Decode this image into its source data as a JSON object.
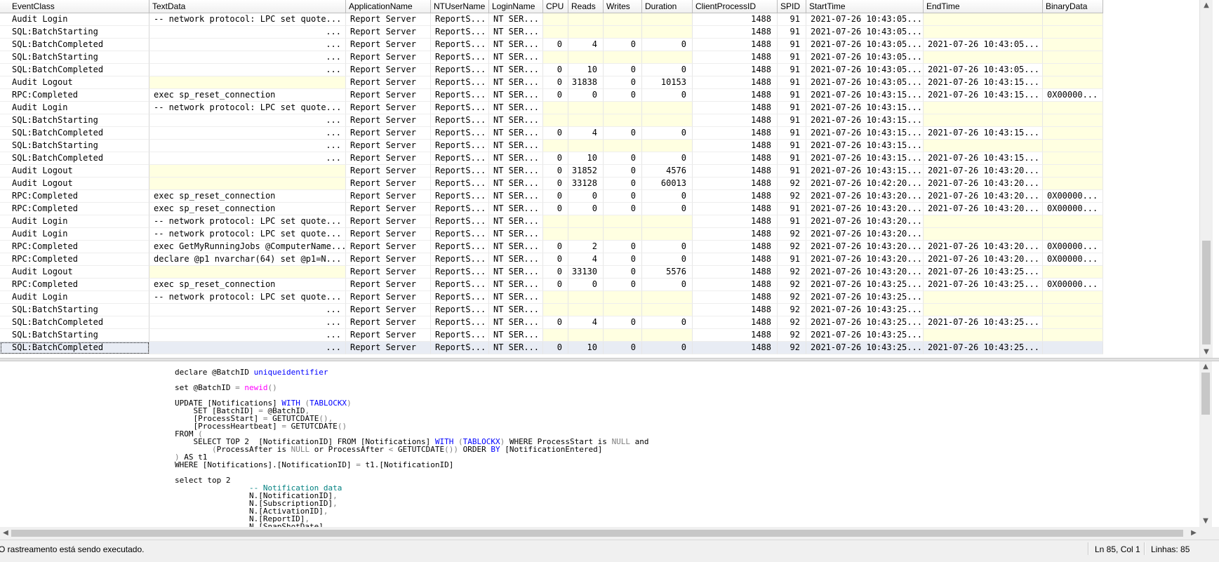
{
  "grid": {
    "columns": [
      "EventClass",
      "TextData",
      "ApplicationName",
      "NTUserName",
      "LoginName",
      "CPU",
      "Reads",
      "Writes",
      "Duration",
      "ClientProcessID",
      "SPID",
      "StartTime",
      "EndTime",
      "BinaryData"
    ],
    "rows": [
      [
        "Audit Login",
        "-- network protocol: LPC  set quote...",
        "Report Server",
        "ReportS...",
        "NT SER...",
        "",
        "",
        "",
        "",
        "1488",
        "91",
        "2021-07-26 10:43:05...",
        "",
        ""
      ],
      [
        "SQL:BatchStarting",
        "...",
        "Report Server",
        "ReportS...",
        "NT SER...",
        "",
        "",
        "",
        "",
        "1488",
        "91",
        "2021-07-26 10:43:05...",
        "",
        ""
      ],
      [
        "SQL:BatchCompleted",
        "...",
        "Report Server",
        "ReportS...",
        "NT SER...",
        "0",
        "4",
        "0",
        "0",
        "1488",
        "91",
        "2021-07-26 10:43:05...",
        "2021-07-26 10:43:05...",
        ""
      ],
      [
        "SQL:BatchStarting",
        "...",
        "Report Server",
        "ReportS...",
        "NT SER...",
        "",
        "",
        "",
        "",
        "1488",
        "91",
        "2021-07-26 10:43:05...",
        "",
        ""
      ],
      [
        "SQL:BatchCompleted",
        "...",
        "Report Server",
        "ReportS...",
        "NT SER...",
        "0",
        "10",
        "0",
        "0",
        "1488",
        "91",
        "2021-07-26 10:43:05...",
        "2021-07-26 10:43:05...",
        ""
      ],
      [
        "Audit Logout",
        "",
        "Report Server",
        "ReportS...",
        "NT SER...",
        "0",
        "31838",
        "0",
        "10153",
        "1488",
        "91",
        "2021-07-26 10:43:05...",
        "2021-07-26 10:43:15...",
        ""
      ],
      [
        "RPC:Completed",
        "exec sp_reset_connection",
        "Report Server",
        "ReportS...",
        "NT SER...",
        "0",
        "0",
        "0",
        "0",
        "1488",
        "91",
        "2021-07-26 10:43:15...",
        "2021-07-26 10:43:15...",
        "0X00000..."
      ],
      [
        "Audit Login",
        "-- network protocol: LPC  set quote...",
        "Report Server",
        "ReportS...",
        "NT SER...",
        "",
        "",
        "",
        "",
        "1488",
        "91",
        "2021-07-26 10:43:15...",
        "",
        ""
      ],
      [
        "SQL:BatchStarting",
        "...",
        "Report Server",
        "ReportS...",
        "NT SER...",
        "",
        "",
        "",
        "",
        "1488",
        "91",
        "2021-07-26 10:43:15...",
        "",
        ""
      ],
      [
        "SQL:BatchCompleted",
        "...",
        "Report Server",
        "ReportS...",
        "NT SER...",
        "0",
        "4",
        "0",
        "0",
        "1488",
        "91",
        "2021-07-26 10:43:15...",
        "2021-07-26 10:43:15...",
        ""
      ],
      [
        "SQL:BatchStarting",
        "...",
        "Report Server",
        "ReportS...",
        "NT SER...",
        "",
        "",
        "",
        "",
        "1488",
        "91",
        "2021-07-26 10:43:15...",
        "",
        ""
      ],
      [
        "SQL:BatchCompleted",
        "...",
        "Report Server",
        "ReportS...",
        "NT SER...",
        "0",
        "10",
        "0",
        "0",
        "1488",
        "91",
        "2021-07-26 10:43:15...",
        "2021-07-26 10:43:15...",
        ""
      ],
      [
        "Audit Logout",
        "",
        "Report Server",
        "ReportS...",
        "NT SER...",
        "0",
        "31852",
        "0",
        "4576",
        "1488",
        "91",
        "2021-07-26 10:43:15...",
        "2021-07-26 10:43:20...",
        ""
      ],
      [
        "Audit Logout",
        "",
        "Report Server",
        "ReportS...",
        "NT SER...",
        "0",
        "33128",
        "0",
        "60013",
        "1488",
        "92",
        "2021-07-26 10:42:20...",
        "2021-07-26 10:43:20...",
        ""
      ],
      [
        "RPC:Completed",
        "exec sp_reset_connection",
        "Report Server",
        "ReportS...",
        "NT SER...",
        "0",
        "0",
        "0",
        "0",
        "1488",
        "92",
        "2021-07-26 10:43:20...",
        "2021-07-26 10:43:20...",
        "0X00000..."
      ],
      [
        "RPC:Completed",
        "exec sp_reset_connection",
        "Report Server",
        "ReportS...",
        "NT SER...",
        "0",
        "0",
        "0",
        "0",
        "1488",
        "91",
        "2021-07-26 10:43:20...",
        "2021-07-26 10:43:20...",
        "0X00000..."
      ],
      [
        "Audit Login",
        "-- network protocol: LPC  set quote...",
        "Report Server",
        "ReportS...",
        "NT SER...",
        "",
        "",
        "",
        "",
        "1488",
        "91",
        "2021-07-26 10:43:20...",
        "",
        ""
      ],
      [
        "Audit Login",
        "-- network protocol: LPC  set quote...",
        "Report Server",
        "ReportS...",
        "NT SER...",
        "",
        "",
        "",
        "",
        "1488",
        "92",
        "2021-07-26 10:43:20...",
        "",
        ""
      ],
      [
        "RPC:Completed",
        "exec GetMyRunningJobs @ComputerName...",
        "Report Server",
        "ReportS...",
        "NT SER...",
        "0",
        "2",
        "0",
        "0",
        "1488",
        "92",
        "2021-07-26 10:43:20...",
        "2021-07-26 10:43:20...",
        "0X00000..."
      ],
      [
        "RPC:Completed",
        "declare @p1 nvarchar(64)  set @p1=N...",
        "Report Server",
        "ReportS...",
        "NT SER...",
        "0",
        "4",
        "0",
        "0",
        "1488",
        "91",
        "2021-07-26 10:43:20...",
        "2021-07-26 10:43:20...",
        "0X00000..."
      ],
      [
        "Audit Logout",
        "",
        "Report Server",
        "ReportS...",
        "NT SER...",
        "0",
        "33130",
        "0",
        "5576",
        "1488",
        "92",
        "2021-07-26 10:43:20...",
        "2021-07-26 10:43:25...",
        ""
      ],
      [
        "RPC:Completed",
        "exec sp_reset_connection",
        "Report Server",
        "ReportS...",
        "NT SER...",
        "0",
        "0",
        "0",
        "0",
        "1488",
        "92",
        "2021-07-26 10:43:25...",
        "2021-07-26 10:43:25...",
        "0X00000..."
      ],
      [
        "Audit Login",
        "-- network protocol: LPC  set quote...",
        "Report Server",
        "ReportS...",
        "NT SER...",
        "",
        "",
        "",
        "",
        "1488",
        "92",
        "2021-07-26 10:43:25...",
        "",
        ""
      ],
      [
        "SQL:BatchStarting",
        "...",
        "Report Server",
        "ReportS...",
        "NT SER...",
        "",
        "",
        "",
        "",
        "1488",
        "92",
        "2021-07-26 10:43:25...",
        "",
        ""
      ],
      [
        "SQL:BatchCompleted",
        "...",
        "Report Server",
        "ReportS...",
        "NT SER...",
        "0",
        "4",
        "0",
        "0",
        "1488",
        "92",
        "2021-07-26 10:43:25...",
        "2021-07-26 10:43:25...",
        ""
      ],
      [
        "SQL:BatchStarting",
        "...",
        "Report Server",
        "ReportS...",
        "NT SER...",
        "",
        "",
        "",
        "",
        "1488",
        "92",
        "2021-07-26 10:43:25...",
        "",
        ""
      ],
      [
        "SQL:BatchCompleted",
        "...",
        "Report Server",
        "ReportS...",
        "NT SER...",
        "0",
        "10",
        "0",
        "0",
        "1488",
        "92",
        "2021-07-26 10:43:25...",
        "2021-07-26 10:43:25...",
        ""
      ]
    ],
    "selected_row": 26
  },
  "text_pane": {
    "sql_lines": [
      "declare @BatchID uniqueidentifier",
      "",
      "set @BatchID = newid()",
      "",
      "UPDATE [Notifications] WITH (TABLOCKX)",
      "    SET [BatchID] = @BatchID,",
      "    [ProcessStart] = GETUTCDATE(),",
      "    [ProcessHeartbeat] = GETUTCDATE()",
      "FROM (",
      "    SELECT TOP 2  [NotificationID] FROM [Notifications] WITH (TABLOCKX) WHERE ProcessStart is NULL and",
      "        (ProcessAfter is NULL or ProcessAfter < GETUTCDATE()) ORDER BY [NotificationEntered]",
      ") AS t1",
      "WHERE [Notifications].[NotificationID] = t1.[NotificationID]",
      "",
      "select top 2",
      "                -- Notification data",
      "                N.[NotificationID],",
      "                N.[SubscriptionID],",
      "                N.[ActivationID],",
      "                N.[ReportID],",
      "                N.[SnapShotDate],"
    ],
    "syntax_colors": {
      "keyword": "#0000ff",
      "function": "#ff00ff",
      "operator": "#808080",
      "comment": "#008080"
    }
  },
  "status_bar": {
    "message": "O rastreamento está sendo executado.",
    "position": "Ln 85, Col 1",
    "lines": "Linhas: 85"
  },
  "scrollbar_icons": {
    "up": "scroll-up-arrow-icon",
    "down": "scroll-down-arrow-icon",
    "left": "scroll-left-arrow-icon",
    "right": "scroll-right-arrow-icon"
  }
}
